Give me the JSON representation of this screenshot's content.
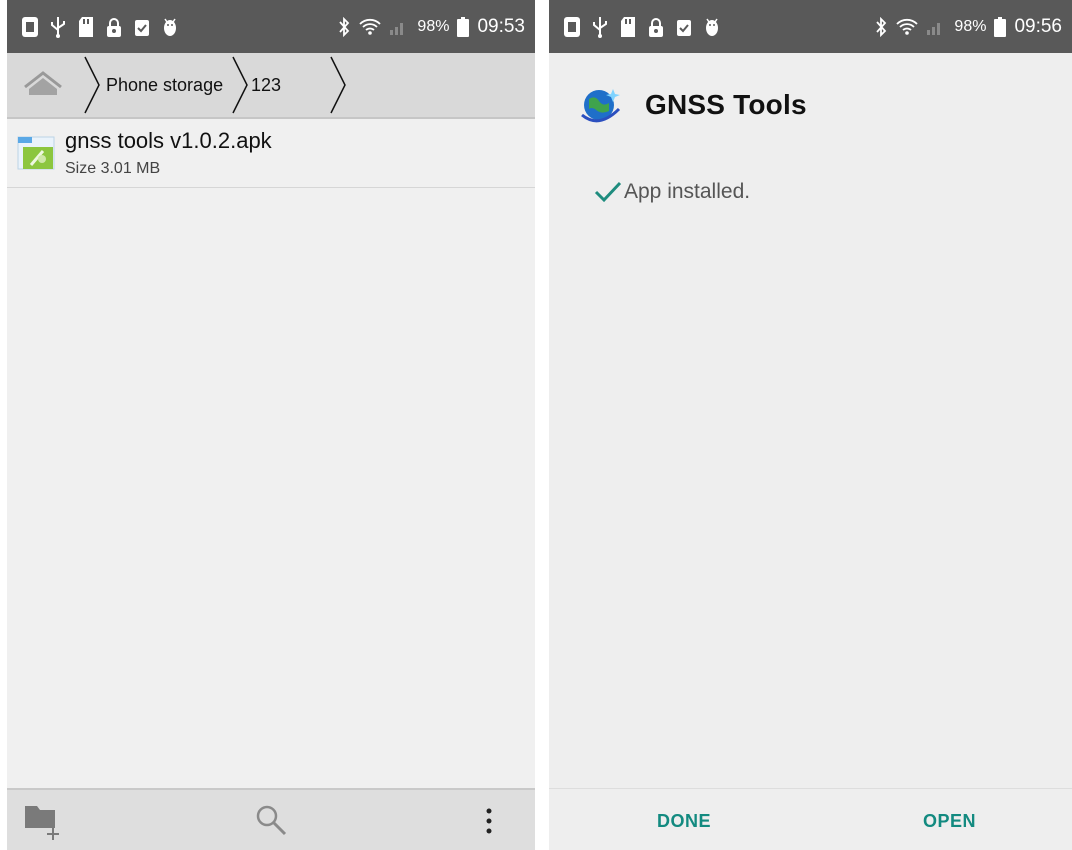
{
  "left_screen": {
    "statusbar": {
      "icons": [
        "sim-icon",
        "usb-icon",
        "sd-card-icon",
        "lock-icon",
        "clipboard-icon",
        "android-debug-icon"
      ],
      "battery_percent": "98%",
      "time": "09:53"
    },
    "breadcrumb": {
      "items": [
        "Phone storage",
        "123"
      ]
    },
    "files": [
      {
        "name": "gnss tools v1.0.2.apk",
        "size": "Size 3.01 MB",
        "icon": "apk-file-icon"
      }
    ],
    "bottombar": {
      "icons": [
        "new-folder-icon",
        "search-icon",
        "more-options-icon"
      ]
    }
  },
  "right_screen": {
    "statusbar": {
      "icons": [
        "sim-icon",
        "usb-icon",
        "sd-card-icon",
        "lock-icon",
        "clipboard-icon",
        "android-debug-icon"
      ],
      "battery_percent": "98%",
      "time": "09:56"
    },
    "app": {
      "name": "GNSS Tools",
      "icon": "gnss-globe-icon",
      "status": "App installed."
    },
    "actions": {
      "done": "DONE",
      "open": "OPEN"
    }
  },
  "colors": {
    "statusbar": "#595959",
    "accent": "#138a80",
    "check": "#1e8c7e",
    "screen_bg": "#eeeeee"
  }
}
